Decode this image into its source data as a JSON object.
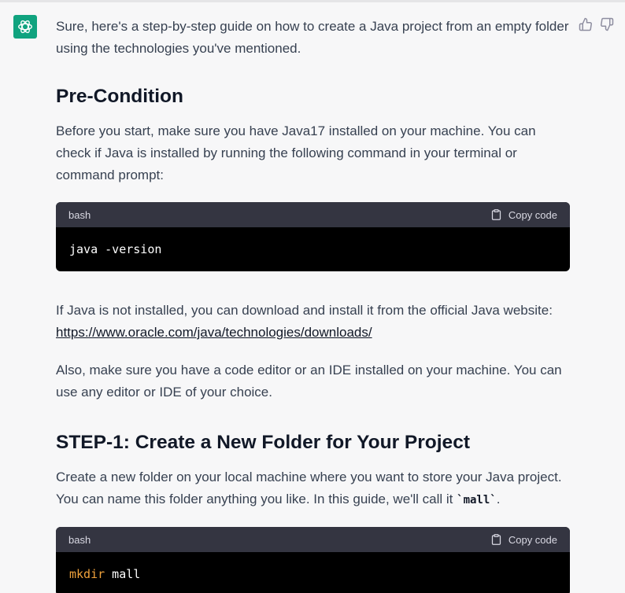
{
  "message": {
    "intro": "Sure, here's a step-by-step guide on how to create a Java project from an empty folder using the technologies you've mentioned.",
    "precondition": {
      "heading": "Pre-Condition",
      "text": "Before you start, make sure you have Java17 installed on your machine. You can check if Java is installed by running the following command in your terminal or command prompt:",
      "code": {
        "lang": "bash",
        "copy_label": "Copy code",
        "line": "java -version"
      },
      "install_text": "If Java is not installed, you can download and install it from the official Java website:",
      "install_link": "https://www.oracle.com/java/technologies/downloads/",
      "editor_text": "Also, make sure you have a code editor or an IDE installed on your machine. You can use any editor or IDE of your choice."
    },
    "step1": {
      "heading": "STEP-1: Create a New Folder for Your Project",
      "text_before": "Create a new folder on your local machine where you want to store your Java project. You can name this folder anything you like. In this guide, we'll call it ",
      "inline_code": "`mall`",
      "text_after": ".",
      "code": {
        "lang": "bash",
        "copy_label": "Copy code",
        "keyword": "mkdir",
        "arg": " mall"
      }
    }
  },
  "icons": {
    "avatar": "openai-logo-icon",
    "thumbs_up": "thumbs-up-icon",
    "thumbs_down": "thumbs-down-icon",
    "copy": "clipboard-icon"
  },
  "colors": {
    "avatar_bg": "#10a37f",
    "code_header_bg": "#343541",
    "code_bg": "#000000",
    "keyword": "#f0a23b",
    "page_bg": "#f7f7f8"
  }
}
